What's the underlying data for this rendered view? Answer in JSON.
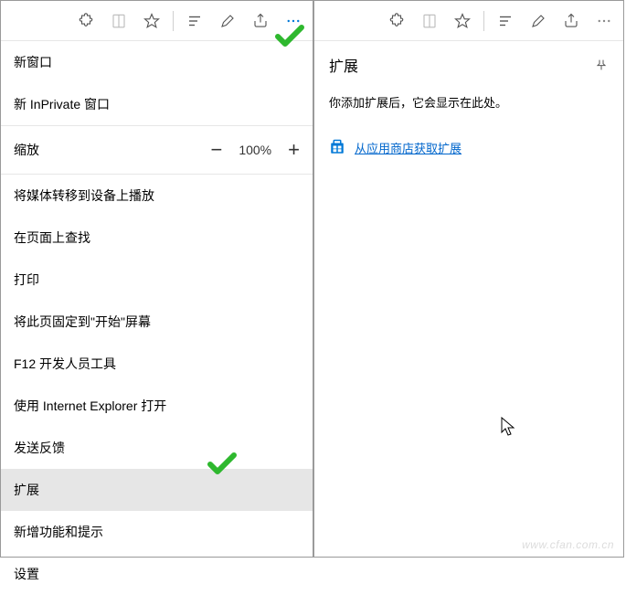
{
  "left_panel": {
    "toolbar_icons": [
      "puzzle-icon",
      "reading-list-icon",
      "favorite-icon",
      "hub-icon",
      "notes-icon",
      "share-icon",
      "more-icon"
    ],
    "menu": {
      "new_window": "新窗口",
      "new_inprivate": "新 InPrivate 窗口",
      "zoom_label": "缩放",
      "zoom_value": "100%",
      "cast": "将媒体转移到设备上播放",
      "find": "在页面上查找",
      "print": "打印",
      "pin_to_start": "将此页固定到\"开始\"屏幕",
      "dev_tools": "F12 开发人员工具",
      "open_ie": "使用 Internet Explorer 打开",
      "feedback": "发送反馈",
      "extensions": "扩展",
      "whats_new": "新增功能和提示",
      "settings": "设置"
    }
  },
  "right_panel": {
    "toolbar_icons": [
      "puzzle-icon",
      "reading-list-icon",
      "favorite-icon",
      "hub-icon",
      "notes-icon",
      "share-icon",
      "more-icon"
    ],
    "title": "扩展",
    "body_text": "你添加扩展后，它会显示在此处。",
    "store_link": "从应用商店获取扩展"
  },
  "watermark": "www.cfan.com.cn"
}
